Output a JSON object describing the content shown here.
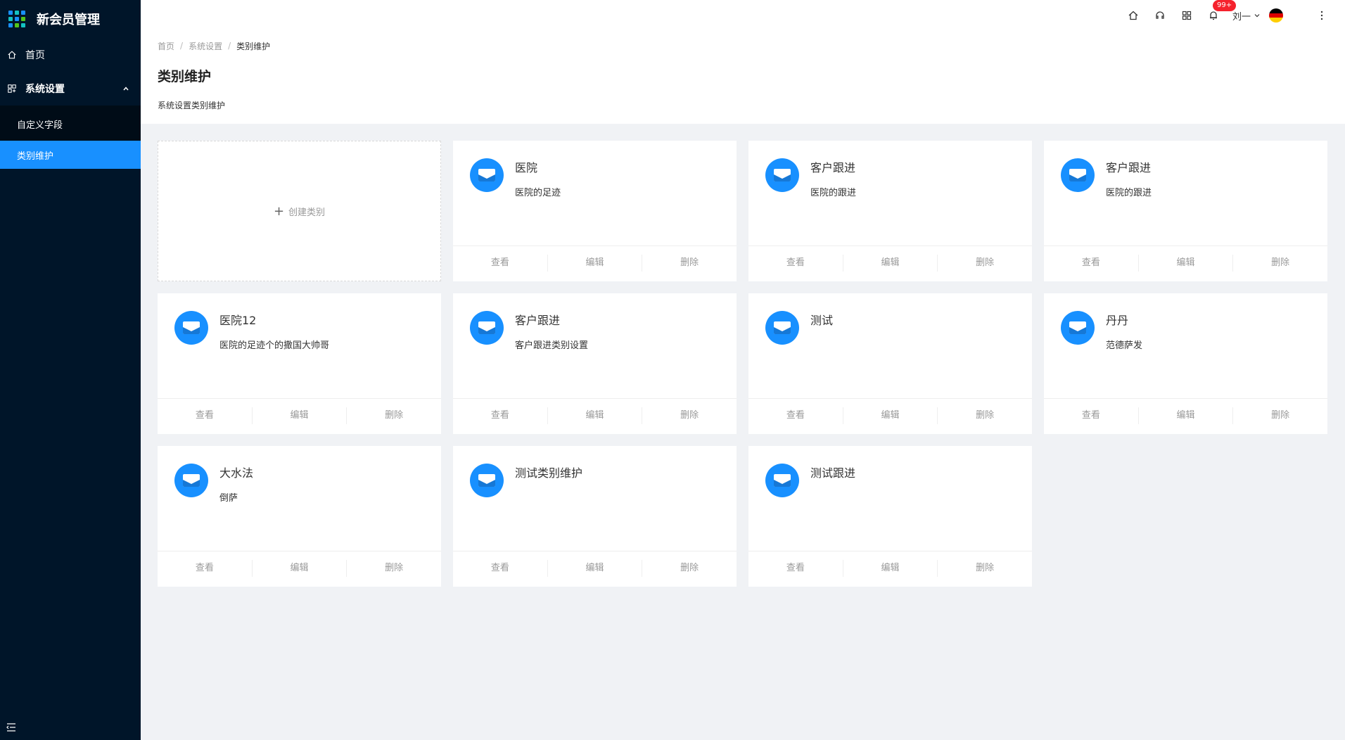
{
  "app": {
    "title": "新会员管理"
  },
  "sidebar": {
    "home_label": "首页",
    "settings_label": "系统设置",
    "sub_items": [
      {
        "label": "自定义字段",
        "active": false
      },
      {
        "label": "类别维护",
        "active": true
      }
    ]
  },
  "header": {
    "notification_count": "99+",
    "user_name": "刘一"
  },
  "page": {
    "breadcrumb": [
      "首页",
      "系统设置",
      "类别维护"
    ],
    "title": "类别维护",
    "description": "系统设置类别维护"
  },
  "create_label": "创建类别",
  "actions": {
    "view": "查看",
    "edit": "编辑",
    "delete": "删除"
  },
  "cards": [
    {
      "title": "医院",
      "desc": "医院的足迹"
    },
    {
      "title": "客户跟进",
      "desc": "医院的跟进"
    },
    {
      "title": "客户跟进",
      "desc": "医院的跟进"
    },
    {
      "title": "医院12",
      "desc": "医院的足迹个的撒国大帅哥"
    },
    {
      "title": "客户跟进",
      "desc": "客户跟进类别设置"
    },
    {
      "title": "测试",
      "desc": ""
    },
    {
      "title": "丹丹",
      "desc": "范德萨发"
    },
    {
      "title": "大水法",
      "desc": "倒萨"
    },
    {
      "title": "测试类别维护",
      "desc": ""
    },
    {
      "title": "测试跟进",
      "desc": ""
    }
  ],
  "colors": {
    "sidebar_bg": "#001529",
    "accent": "#1890ff",
    "badge": "#f5222d"
  }
}
